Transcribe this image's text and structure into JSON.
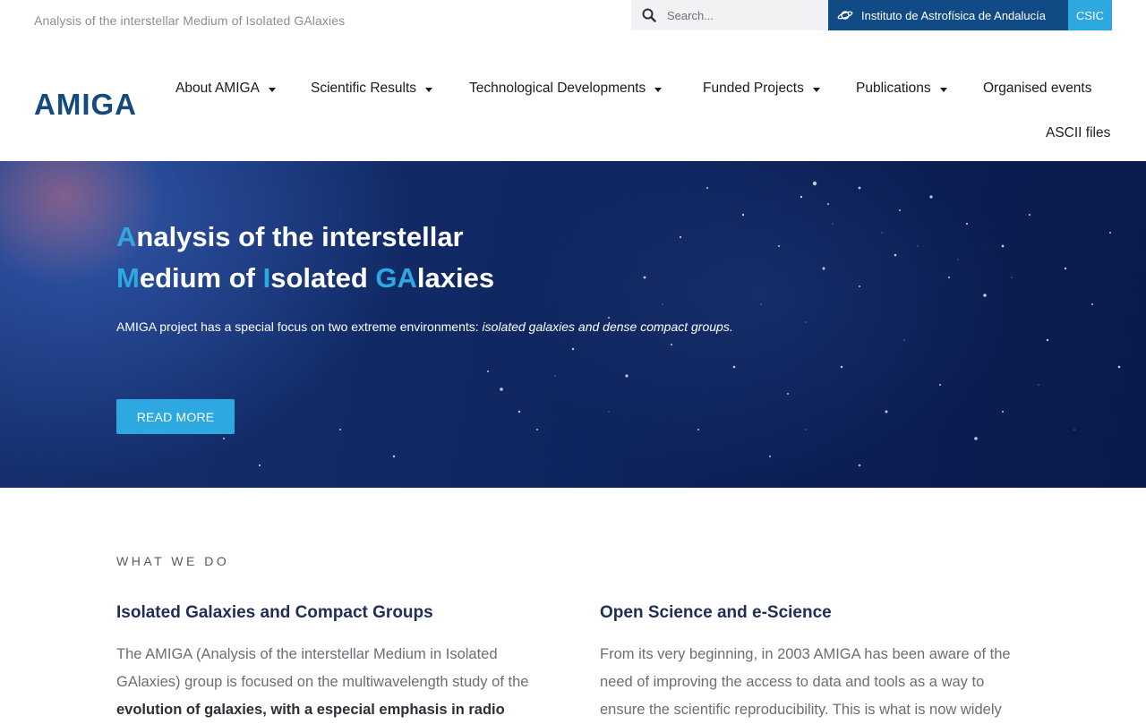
{
  "topbar": {
    "tagline": "Analysis of the interstellar Medium of Isolated GAlaxies",
    "search_placeholder": "Search...",
    "iaa_label": "Instituto de Astrofísica de Andalucía",
    "csic_label": "CSIC"
  },
  "header": {
    "logo": "AMIGA"
  },
  "nav": {
    "items": [
      {
        "label": "About AMIGA"
      },
      {
        "label": "Scientific Results"
      },
      {
        "label": "Technological Developments"
      },
      {
        "label": "Funded Projects"
      },
      {
        "label": "Publications"
      },
      {
        "label": "Organised events"
      },
      {
        "label": "ASCII files"
      }
    ]
  },
  "hero": {
    "title": {
      "l1_hl": "A",
      "l1_rest": "nalysis of the interstellar",
      "l2_hl1": "M",
      "l2_rest1": "edium of ",
      "l2_hl2": "I",
      "l2_rest2": "solated ",
      "l2_hl3": "GA",
      "l2_rest3": "laxies"
    },
    "text_plain": "AMIGA project has a special focus on two extreme environments: ",
    "text_italic": "isolated galaxies and dense compact groups.",
    "button_label": "READ MORE"
  },
  "what_we_do": {
    "kicker": "WHAT WE DO",
    "left": {
      "heading": "Isolated Galaxies and Compact Groups",
      "text_plain": "The AMIGA (Analysis of the interstellar Medium in Isolated GAlaxies) group is focused on the multiwavelength study of the ",
      "text_bold": "evolution of galaxies, with a especial emphasis in radio"
    },
    "right": {
      "heading": "Open Science and e-Science",
      "text": "From its very beginning, in 2003 AMIGA has been aware of the need of improving the access to data and tools as a way to ensure the scientific reproducibility. This is what is now widely"
    }
  },
  "colors": {
    "brand_dark": "#114b86",
    "accent": "#2da8e0",
    "logo": "#154a7d",
    "heading": "#1f2e56"
  }
}
